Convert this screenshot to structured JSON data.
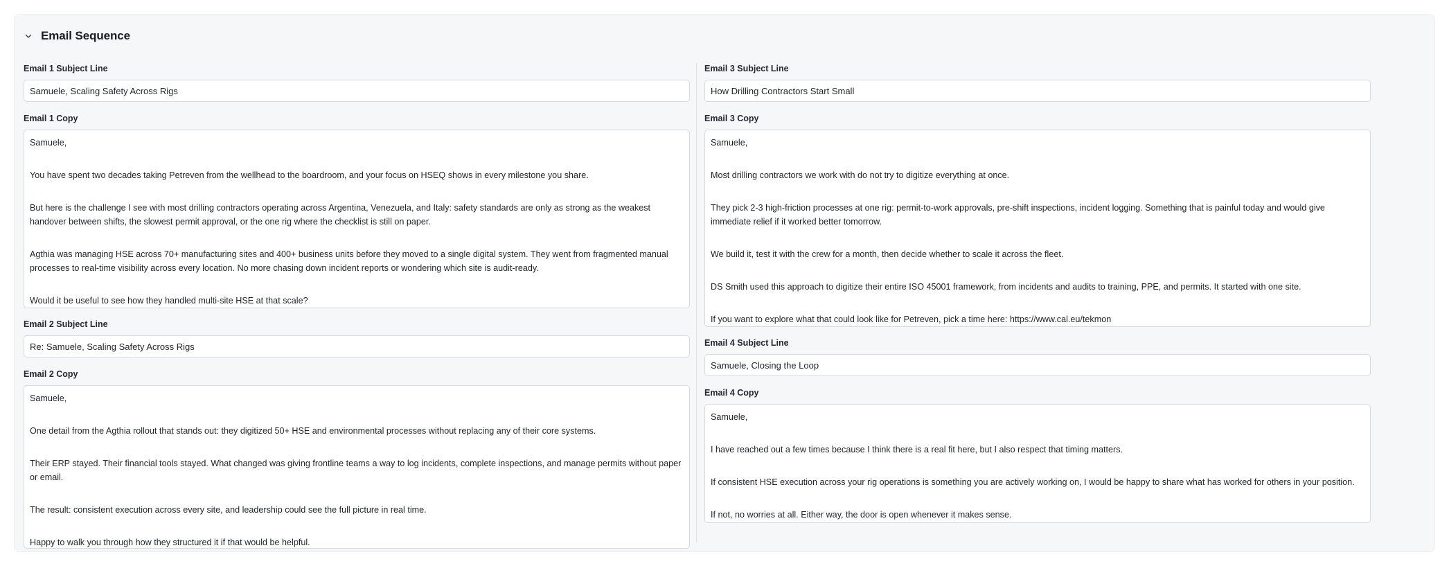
{
  "section": {
    "title": "Email Sequence"
  },
  "emails": {
    "e1": {
      "subject_label": "Email 1 Subject Line",
      "subject_value": "Samuele, Scaling Safety Across Rigs",
      "copy_label": "Email 1 Copy",
      "paragraphs": [
        "Samuele,",
        "You have spent two decades taking Petreven from the wellhead to the boardroom, and your focus on HSEQ shows in every milestone you share.",
        "But here is the challenge I see with most drilling contractors operating across Argentina, Venezuela, and Italy: safety standards are only as strong as the weakest handover between shifts, the slowest permit approval, or the one rig where the checklist is still on paper.",
        "Agthia was managing HSE across 70+ manufacturing sites and 400+ business units before they moved to a single digital system. They went from fragmented manual processes to real-time visibility across every location. No more chasing down incident reports or wondering which site is audit-ready.",
        "Would it be useful to see how they handled multi-site HSE at that scale?"
      ]
    },
    "e2": {
      "subject_label": "Email 2 Subject Line",
      "subject_value": "Re: Samuele, Scaling Safety Across Rigs",
      "copy_label": "Email 2 Copy",
      "paragraphs": [
        "Samuele,",
        "One detail from the Agthia rollout that stands out: they digitized 50+ HSE and environmental processes without replacing any of their core systems.",
        "Their ERP stayed. Their financial tools stayed. What changed was giving frontline teams a way to log incidents, complete inspections, and manage permits without paper or email.",
        "The result: consistent execution across every site, and leadership could see the full picture in real time.",
        "Happy to walk you through how they structured it if that would be helpful."
      ]
    },
    "e3": {
      "subject_label": "Email 3 Subject Line",
      "subject_value": "How Drilling Contractors Start Small",
      "copy_label": "Email 3 Copy",
      "paragraphs": [
        "Samuele,",
        "Most drilling contractors we work with do not try to digitize everything at once.",
        "They pick 2-3 high-friction processes at one rig: permit-to-work approvals, pre-shift inspections, incident logging. Something that is painful today and would give immediate relief if it worked better tomorrow.",
        "We build it, test it with the crew for a month, then decide whether to scale it across the fleet.",
        "DS Smith used this approach to digitize their entire ISO 45001 framework, from incidents and audits to training, PPE, and permits. It started with one site.",
        "If you want to explore what that could look like for Petreven, pick a time here: https://www.cal.eu/tekmon"
      ]
    },
    "e4": {
      "subject_label": "Email 4 Subject Line",
      "subject_value": "Samuele, Closing the Loop",
      "copy_label": "Email 4 Copy",
      "paragraphs": [
        "Samuele,",
        "I have reached out a few times because I think there is a real fit here, but I also respect that timing matters.",
        "If consistent HSE execution across your rig operations is something you are actively working on, I would be happy to share what has worked for others in your position.",
        "If not, no worries at all. Either way, the door is open whenever it makes sense."
      ]
    }
  }
}
